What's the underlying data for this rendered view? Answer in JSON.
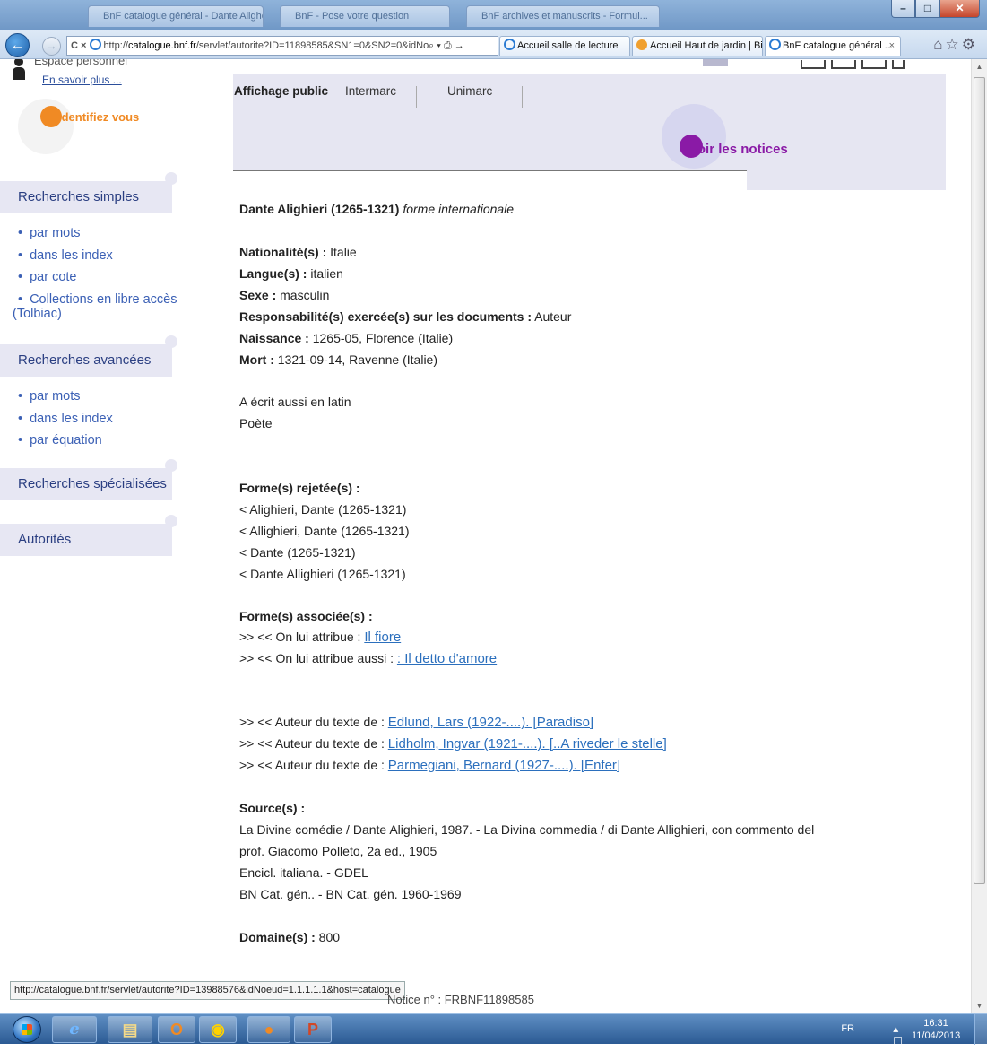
{
  "browser": {
    "bg_tabs": [
      "BnF catalogue général - Dante Aligheri...",
      "BnF - Pose votre question",
      "BnF archives et manuscrits - Formul..."
    ],
    "back_label": "←",
    "fwd_label": "→",
    "address_controls": "C ×",
    "url_prefix": "http://",
    "url_domain": "catalogue.bnf.fr",
    "url_rest": "/servlet/autorite?ID=11898585&SN1=0&SN2=0&idNoeud=1",
    "search_arrow": "⌕ ▾ ⎙ →",
    "tabs": [
      {
        "label": "Accueil salle de lecture"
      },
      {
        "label": "Accueil Haut de jardin | Bi..."
      },
      {
        "label": "BnF catalogue général ...",
        "close": "×"
      }
    ],
    "toolbar_icons": "⌂☆⚙",
    "window_controls": [
      "–",
      "□",
      "✕"
    ]
  },
  "sidebar": {
    "espace_title": "Espace personnel",
    "en_savoir": "En savoir plus ...",
    "identifiez": "Identifiez vous",
    "sections": [
      {
        "title": "Recherches simples",
        "items": [
          "par mots",
          "dans les index",
          "par cote",
          "Collections en libre accès",
          "(Tolbiac)"
        ]
      },
      {
        "title": "Recherches avancées",
        "items": [
          "par mots",
          "dans les index",
          "par équation"
        ]
      },
      {
        "title": "Recherches spécialisées",
        "items": []
      },
      {
        "title": "Autorités",
        "items": []
      }
    ]
  },
  "content": {
    "tabs": [
      "Affichage public",
      "Intermarc",
      "Unimarc"
    ],
    "voir_notices": "Voir les notices",
    "heading": "Dante Alighieri (1265-1321)",
    "heading_form": "forme internationale",
    "fields": [
      {
        "label": "Nationalité(s) :",
        "value": " Italie"
      },
      {
        "label": "Langue(s) :",
        "value": " italien"
      },
      {
        "label": "Sexe :",
        "value": " masculin"
      },
      {
        "label": "Responsabilité(s) exercée(s) sur les documents :",
        "value": " Auteur"
      },
      {
        "label": "Naissance :",
        "value": " 1265-05, Florence (Italie)"
      },
      {
        "label": "Mort :",
        "value": " 1321-09-14, Ravenne (Italie)"
      }
    ],
    "notes": [
      "A écrit aussi en latin",
      "Poète"
    ],
    "rejected_label": "Forme(s) rejetée(s) :",
    "rejected": [
      "< Alighieri, Dante (1265-1321)",
      "< Allighieri, Dante (1265-1321)",
      "< Dante (1265-1321)",
      "< Dante Allighieri (1265-1321)"
    ],
    "associated_label": "Forme(s) associée(s) :",
    "associated": [
      {
        "prefix": ">> << On lui attribue : ",
        "link": "Il fiore"
      },
      {
        "prefix": ">> << On lui attribue aussi : ",
        "link": ": Il detto d'amore"
      }
    ],
    "authors": [
      {
        "prefix": ">> << Auteur du texte de : ",
        "link": "Edlund, Lars (1922-....). [Paradiso]"
      },
      {
        "prefix": ">> << Auteur du texte de : ",
        "link": "Lidholm, Ingvar (1921-....). [..A riveder le stelle]"
      },
      {
        "prefix": ">> << Auteur du texte de : ",
        "link": "Parmegiani, Bernard (1927-....). [Enfer]"
      }
    ],
    "sources_label": "Source(s) :",
    "sources": [
      "La Divine comédie / Dante Alighieri, 1987. - La Divina commedia / di Dante Allighieri, con commento del",
      "prof. Giacomo Polleto, 2a ed., 1905",
      "Encicl. italiana. - GDEL",
      "BN Cat. gén.. - BN Cat. gén. 1960-1969"
    ],
    "domaine_label": "Domaine(s) :",
    "domaine_value": " 800",
    "peek_text": "Notice n° : FRBNF11898585"
  },
  "status_url": "http://catalogue.bnf.fr/servlet/autorite?ID=13988576&idNoeud=1.1.1.1.1&host=catalogue",
  "taskbar": {
    "lang": "FR",
    "tray_icons": "▴ ☐ ♪",
    "time": "16:31",
    "date": "11/04/2013"
  }
}
